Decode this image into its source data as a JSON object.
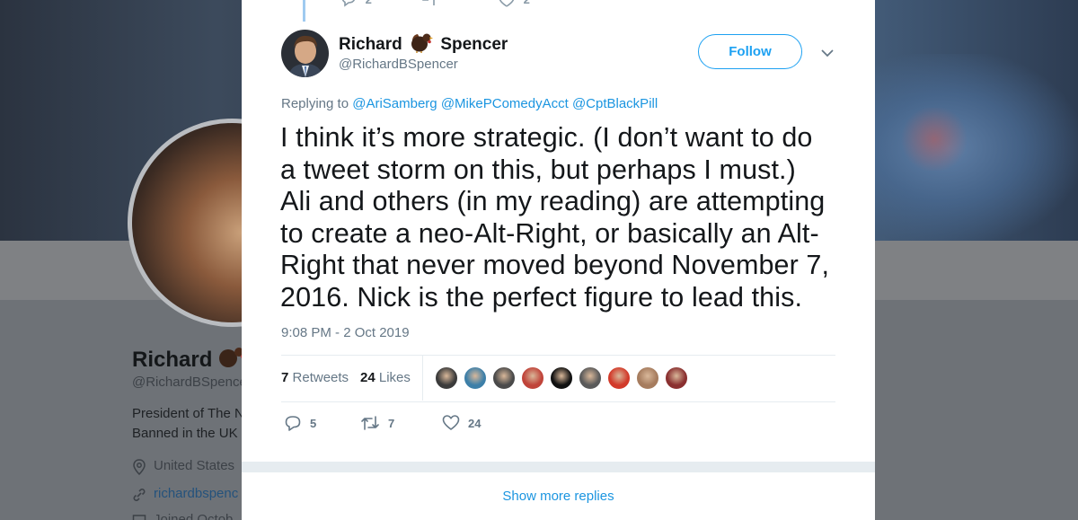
{
  "background_profile": {
    "name": "Richard",
    "handle": "@RichardBSpence",
    "bio_line_1": "President of The N",
    "bio_line_2": "Banned in the UK",
    "location": "United States",
    "link": "richardbspenc",
    "joined": "Joined Octob"
  },
  "previous_tweet": {
    "reply_count": "2",
    "like_count": "2"
  },
  "tweet": {
    "author": {
      "name_first": "Richard",
      "name_last": "Spencer",
      "name_emoji": "turkey-icon",
      "handle": "@RichardBSpencer"
    },
    "follow_label": "Follow",
    "replying_to_prefix": "Replying to",
    "replying_to": [
      "@AriSamberg",
      "@MikePComedyAcct",
      "@CptBlackPill"
    ],
    "text_lines": [
      "I think it’s more strategic. (I don’t want to do",
      "a tweet storm on this, but perhaps I must.)",
      "Ali and others (in my reading) are attempting",
      "to create a neo-Alt-Right, or basically an Alt-",
      "Right that never moved beyond November 7,",
      "2016. Nick is the perfect figure to lead this."
    ],
    "timestamp": "9:08 PM - 2 Oct 2019",
    "retweets_count": "7",
    "retweets_label": "Retweets",
    "likes_count": "24",
    "likes_label": "Likes",
    "actions": {
      "reply_count": "5",
      "retweet_count": "7",
      "like_count": "24"
    },
    "liker_avatar_colors": [
      "#3b3b3b",
      "#3d7fa8",
      "#4a4a4a",
      "#c0443a",
      "#111111",
      "#5a5a5a",
      "#d23a2a",
      "#a67c5e",
      "#8a3030"
    ]
  },
  "show_more_replies_label": "Show more replies",
  "colors": {
    "accent": "#1da1f2",
    "link": "#1b95e0",
    "muted": "#657786"
  }
}
